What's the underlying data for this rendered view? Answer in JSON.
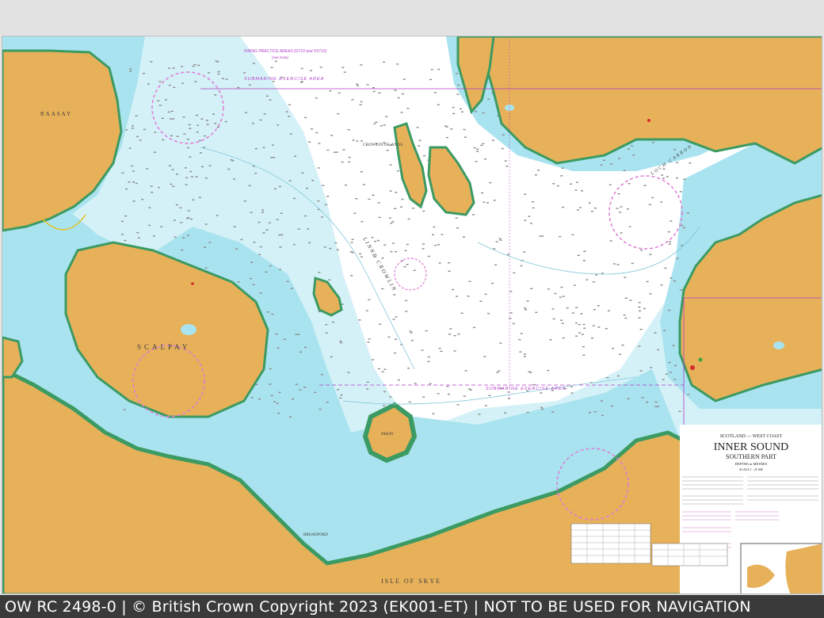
{
  "chart": {
    "region": "SCOTLAND — WEST COAST",
    "title": "INNER SOUND",
    "subtitle": "SOUTHERN PART",
    "depths": "DEPTHS in METRES",
    "scale": "SCALE 1 : 25 000"
  },
  "place_names": {
    "raasay": "RAASAY",
    "crowlin_islands": "CROWLIN ISLANDS",
    "linne_crowlin": "LINNE CROWLIN",
    "scalpay": "SCALPAY",
    "pabay": "PABAY",
    "isle_of_skye": "ISLE OF SKYE",
    "loch_carron": "LOCH CARRON",
    "broadford": "BROADFORD"
  },
  "annotations": {
    "firing_practice_area": "FIRING PRACTICE AREAS (D710 and X5710)",
    "see_note": "(see Note)",
    "submarine_exercise_area_north": "SUBMARINE EXERCISE AREA",
    "submarine_exercise_area_south": "SUBMARINE EXERCISE AREA"
  },
  "footer": {
    "text": "OW RC 2498-0 | © British Crown Copyright 2023 (EK001-ET) | NOT TO BE USED FOR NAVIGATION"
  },
  "colors": {
    "land": "#e7b15a",
    "shallow_water": "#a9e3ef",
    "medium_water": "#d4f1f7",
    "deep_water": "#ffffff",
    "drying": "#3c9a63",
    "purple": "#b23bc7",
    "magenta_circle": "#e07ad8",
    "footer_bg": "#3a3a3a"
  }
}
